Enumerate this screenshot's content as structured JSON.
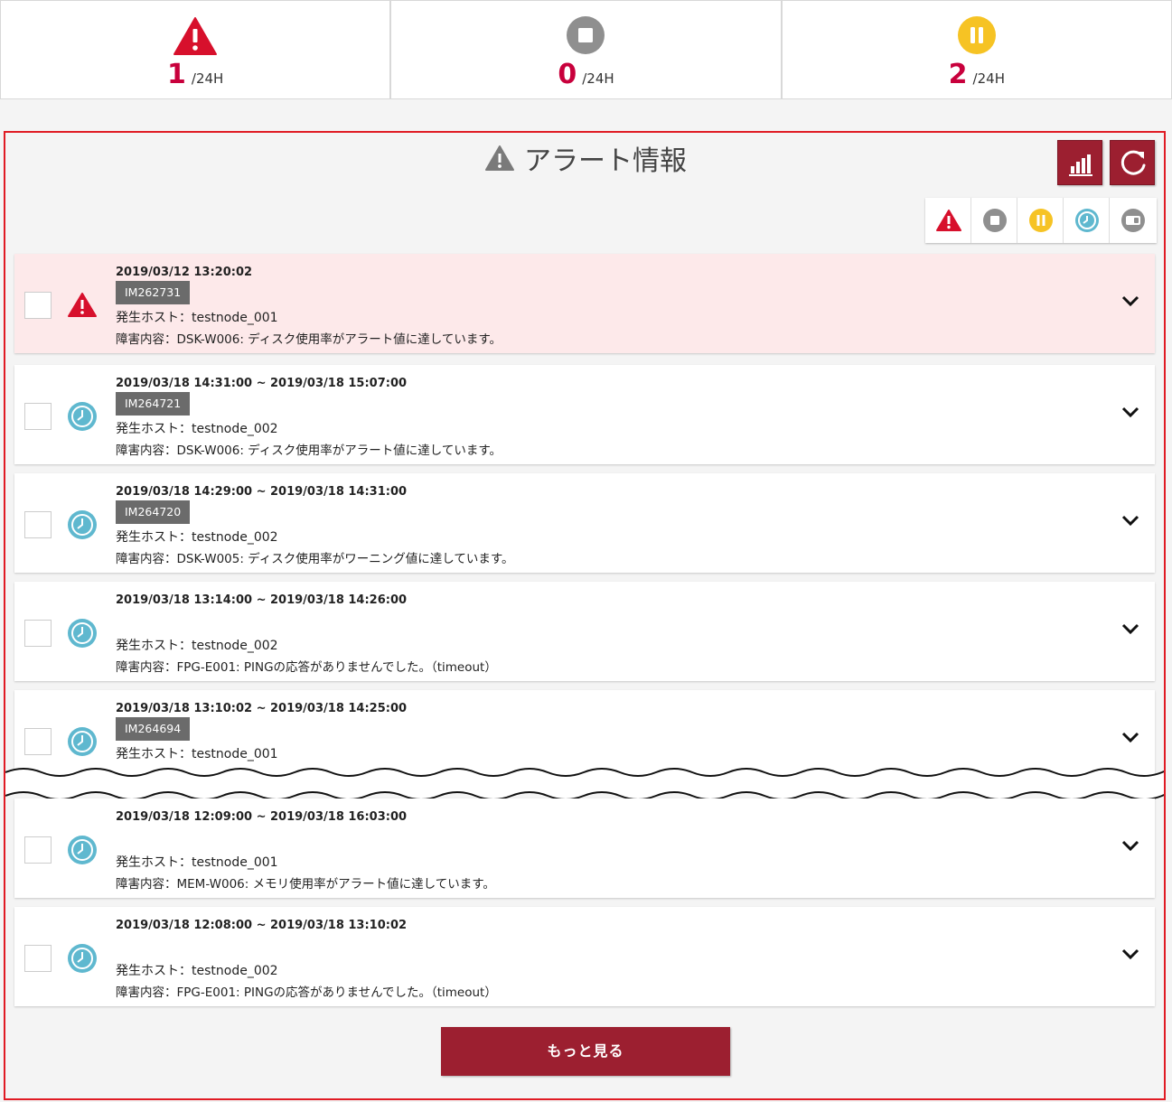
{
  "summary": [
    {
      "icon": "warning-triangle-icon",
      "count": "1",
      "unit": "/24H",
      "color": "#d7102c"
    },
    {
      "icon": "stop-circle-icon",
      "count": "0",
      "unit": "/24H",
      "color": "#8f8f8f"
    },
    {
      "icon": "pause-circle-icon",
      "count": "2",
      "unit": "/24H",
      "color": "#f6c324"
    }
  ],
  "panel": {
    "title": "アラート情報",
    "title_icon": "warning-triangle-icon",
    "chart_button_icon": "bar-chart-icon",
    "refresh_button_icon": "refresh-icon",
    "filters": [
      "alert-filter-icon",
      "stop-filter-icon",
      "pause-filter-icon",
      "recovered-filter-icon",
      "maintenance-filter-icon"
    ]
  },
  "alerts": [
    {
      "status": "alert",
      "date": "2019/03/12 13:20:02",
      "ticket": "IM262731",
      "host": "発生ホスト：testnode_001",
      "message": "障害内容：DSK-W006: ディスク使用率がアラート値に達しています。"
    },
    {
      "status": "recovered",
      "date": "2019/03/18 14:31:00 ~ 2019/03/18 15:07:00",
      "ticket": "IM264721",
      "host": "発生ホスト：testnode_002",
      "message": "障害内容：DSK-W006: ディスク使用率がアラート値に達しています。"
    },
    {
      "status": "recovered",
      "date": "2019/03/18 14:29:00 ~ 2019/03/18 14:31:00",
      "ticket": "IM264720",
      "host": "発生ホスト：testnode_002",
      "message": "障害内容：DSK-W005: ディスク使用率がワーニング値に達しています。"
    },
    {
      "status": "recovered",
      "date": "2019/03/18 13:14:00 ~ 2019/03/18 14:26:00",
      "ticket": "",
      "host": "発生ホスト：testnode_002",
      "message": "障害内容：FPG-E001: PINGの応答がありませんでした。（timeout）"
    },
    {
      "status": "recovered",
      "date": "2019/03/18 13:10:02 ~ 2019/03/18 14:25:00",
      "ticket": "IM264694",
      "host": "発生ホスト：testnode_001",
      "message": ""
    },
    {
      "status": "recovered",
      "date": "2019/03/18 12:09:00 ~ 2019/03/18 16:03:00",
      "ticket": "",
      "host": "発生ホスト：testnode_001",
      "message": "障害内容：MEM-W006: メモリ使用率がアラート値に達しています。"
    },
    {
      "status": "recovered",
      "date": "2019/03/18 12:08:00 ~ 2019/03/18 13:10:02",
      "ticket": "",
      "host": "発生ホスト：testnode_002",
      "message": "障害内容：FPG-E001: PINGの応答がありませんでした。（timeout）"
    }
  ],
  "more_button": "もっと見る",
  "colors": {
    "accent": "#9c1f30",
    "alert": "#d7102c",
    "recovered": "#5fb8cf",
    "pause": "#f6c324",
    "stop": "#8f8f8f",
    "panel_border": "#e01b24"
  }
}
